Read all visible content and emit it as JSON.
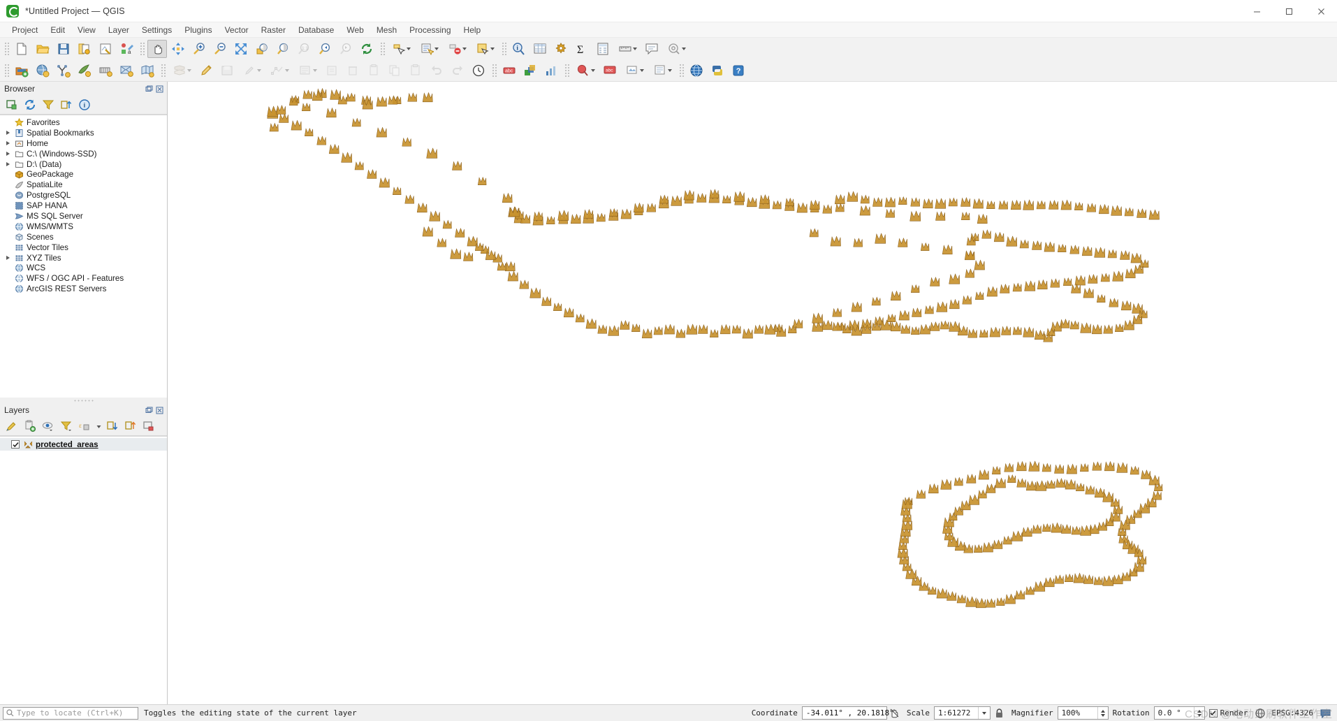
{
  "window": {
    "title": "*Untitled Project — QGIS",
    "logo_name": "qgis-logo",
    "minimize_label": "Minimize",
    "maximize_label": "Maximize",
    "close_label": "Close"
  },
  "menubar": [
    {
      "label": "Project"
    },
    {
      "label": "Edit"
    },
    {
      "label": "View"
    },
    {
      "label": "Layer"
    },
    {
      "label": "Settings"
    },
    {
      "label": "Plugins"
    },
    {
      "label": "Vector"
    },
    {
      "label": "Raster"
    },
    {
      "label": "Database"
    },
    {
      "label": "Web"
    },
    {
      "label": "Mesh"
    },
    {
      "label": "Processing"
    },
    {
      "label": "Help"
    }
  ],
  "browser_panel": {
    "title": "Browser",
    "toolbar": [
      {
        "name": "add-layer-icon",
        "tip": "Add Selected Layers"
      },
      {
        "name": "refresh-icon",
        "tip": "Refresh"
      },
      {
        "name": "filter-icon",
        "tip": "Filter Browser"
      },
      {
        "name": "collapse-all-icon",
        "tip": "Collapse All"
      },
      {
        "name": "properties-info-icon",
        "tip": "Enable/disable properties widget"
      }
    ],
    "items": [
      {
        "label": "Favorites",
        "icon": "star-icon",
        "expandable": false
      },
      {
        "label": "Spatial Bookmarks",
        "icon": "bookmark-icon",
        "expandable": true
      },
      {
        "label": "Home",
        "icon": "home-folder-icon",
        "expandable": true
      },
      {
        "label": "C:\\ (Windows-SSD)",
        "icon": "folder-icon",
        "expandable": true
      },
      {
        "label": "D:\\ (Data)",
        "icon": "folder-icon",
        "expandable": true
      },
      {
        "label": "GeoPackage",
        "icon": "geopackage-icon",
        "expandable": false
      },
      {
        "label": "SpatiaLite",
        "icon": "spatialite-icon",
        "expandable": false
      },
      {
        "label": "PostgreSQL",
        "icon": "postgresql-icon",
        "expandable": false
      },
      {
        "label": "SAP HANA",
        "icon": "sap-hana-icon",
        "expandable": false
      },
      {
        "label": "MS SQL Server",
        "icon": "mssql-icon",
        "expandable": false
      },
      {
        "label": "WMS/WMTS",
        "icon": "globe-icon",
        "expandable": false
      },
      {
        "label": "Scenes",
        "icon": "cube-icon",
        "expandable": false
      },
      {
        "label": "Vector Tiles",
        "icon": "grid-icon",
        "expandable": false
      },
      {
        "label": "XYZ Tiles",
        "icon": "grid-icon",
        "expandable": true
      },
      {
        "label": "WCS",
        "icon": "globe-icon",
        "expandable": false
      },
      {
        "label": "WFS / OGC API - Features",
        "icon": "globe-icon",
        "expandable": false
      },
      {
        "label": "ArcGIS REST Servers",
        "icon": "globe-icon",
        "expandable": false
      }
    ]
  },
  "layers_panel": {
    "title": "Layers",
    "toolbar": [
      {
        "name": "open-layer-styling-icon",
        "tip": "Open the Layer Styling panel"
      },
      {
        "name": "add-group-icon",
        "tip": "Add Group"
      },
      {
        "name": "manage-visibility-icon",
        "tip": "Manage Map Themes"
      },
      {
        "name": "filter-legend-icon",
        "tip": "Filter Legend"
      },
      {
        "name": "expression-filter-icon",
        "tip": "Filter Legend by Expression"
      },
      {
        "name": "expand-all-icon",
        "tip": "Expand All"
      },
      {
        "name": "collapse-all-icon",
        "tip": "Collapse All"
      },
      {
        "name": "remove-layer-icon",
        "tip": "Remove Layer/Group"
      }
    ],
    "layers": [
      {
        "name": "protected_areas",
        "checked": true,
        "editing": true,
        "icon": "point-layer-icon"
      }
    ]
  },
  "toolbar_rows": [
    {
      "groups": [
        {
          "buttons": [
            {
              "name": "new-project-icon",
              "label": "New Project"
            },
            {
              "name": "open-project-icon",
              "label": "Open Project"
            },
            {
              "name": "save-project-icon",
              "label": "Save Project"
            },
            {
              "name": "new-print-layout-icon",
              "label": "New Print Layout"
            },
            {
              "name": "style-manager-icon",
              "label": "Style Manager"
            },
            {
              "name": "show-layout-manager-icon",
              "label": "Layout Manager"
            }
          ]
        },
        {
          "buttons": [
            {
              "name": "pan-map-icon",
              "label": "Pan Map",
              "active": true
            },
            {
              "name": "pan-to-selection-icon",
              "label": "Pan Map to Selection"
            },
            {
              "name": "zoom-in-icon",
              "label": "Zoom In"
            },
            {
              "name": "zoom-out-icon",
              "label": "Zoom Out"
            },
            {
              "name": "zoom-full-icon",
              "label": "Zoom Full"
            },
            {
              "name": "zoom-to-selection-icon",
              "label": "Zoom to Selection"
            },
            {
              "name": "zoom-to-layer-icon",
              "label": "Zoom to Layer"
            },
            {
              "name": "zoom-native-icon",
              "label": "Zoom to Native Resolution",
              "disabled": true
            },
            {
              "name": "zoom-last-icon",
              "label": "Zoom Last"
            },
            {
              "name": "zoom-next-icon",
              "label": "Zoom Next",
              "disabled": true
            },
            {
              "name": "refresh-map-icon",
              "label": "Refresh"
            }
          ]
        },
        {
          "buttons": [
            {
              "name": "select-features-icon",
              "label": "Select Features",
              "dropdown": true
            },
            {
              "name": "select-by-value-icon",
              "label": "Select Features by Value",
              "dropdown": true
            },
            {
              "name": "deselect-icon",
              "label": "Deselect Features",
              "dropdown": true
            },
            {
              "name": "select-all-icon",
              "label": "Select All Features",
              "dropdown": true
            }
          ]
        },
        {
          "buttons": [
            {
              "name": "identify-features-icon",
              "label": "Identify Features"
            },
            {
              "name": "open-attribute-table-icon",
              "label": "Open Attribute Table"
            },
            {
              "name": "processing-toolbox-icon",
              "label": "Processing Toolbox"
            },
            {
              "name": "statistical-summary-icon",
              "label": "Statistical Summary"
            },
            {
              "name": "field-calculator-icon",
              "label": "Field Calculator"
            },
            {
              "name": "measure-line-icon",
              "label": "Measure Line",
              "dropdown": true
            },
            {
              "name": "show-map-tips-icon",
              "label": "Show Map Tips"
            },
            {
              "name": "new-map-view-icon",
              "label": "New Map View",
              "dropdown": true
            }
          ]
        }
      ]
    },
    {
      "groups": [
        {
          "buttons": [
            {
              "name": "add-vector-layer-icon",
              "label": "Add Vector Layer"
            },
            {
              "name": "add-raster-layer-icon",
              "label": "Add Raster Layer"
            },
            {
              "name": "add-delimited-text-icon",
              "label": "Add Delimited Text Layer"
            },
            {
              "name": "add-spatialite-layer-icon",
              "label": "Add SpatiaLite Layer"
            },
            {
              "name": "add-postgis-layer-icon",
              "label": "Add PostGIS Layer"
            },
            {
              "name": "add-mssql-layer-icon",
              "label": "Add MS SQL Server Layer"
            },
            {
              "name": "add-wms-layer-icon",
              "label": "Add WMS/WMTS Layer"
            }
          ]
        },
        {
          "buttons": [
            {
              "name": "current-edits-icon",
              "label": "Current Edits",
              "dropdown": true
            },
            {
              "name": "toggle-editing-icon",
              "label": "Toggle Editing"
            },
            {
              "name": "save-layer-edits-icon",
              "label": "Save Layer Edits"
            },
            {
              "name": "add-point-feature-icon",
              "label": "Add Point Feature",
              "dropdown": true
            },
            {
              "name": "vertex-tool-icon",
              "label": "Vertex Tool",
              "dropdown": true
            },
            {
              "name": "modify-attributes-icon",
              "label": "Modify Attributes of Selected Features",
              "dropdown": true
            },
            {
              "name": "move-feature-icon",
              "label": "Move Feature"
            },
            {
              "name": "delete-selected-icon",
              "label": "Delete Selected"
            },
            {
              "name": "cut-features-icon",
              "label": "Cut Features"
            },
            {
              "name": "copy-features-icon",
              "label": "Copy Features"
            },
            {
              "name": "paste-features-icon",
              "label": "Paste Features"
            },
            {
              "name": "undo-icon",
              "label": "Undo"
            },
            {
              "name": "redo-icon",
              "label": "Redo"
            },
            {
              "name": "temporal-controller-icon",
              "label": "Temporal Controller Panel"
            }
          ]
        },
        {
          "buttons": [
            {
              "name": "label-toolbar-icon",
              "label": "Layer Labeling Options"
            },
            {
              "name": "style-dock-icon",
              "label": "Layer Styling"
            },
            {
              "name": "diagram-icon",
              "label": "Diagram Options"
            }
          ]
        },
        {
          "buttons": [
            {
              "name": "annotation-point-icon",
              "label": "Text Annotation",
              "dropdown": true
            },
            {
              "name": "html-annotation-icon",
              "label": "HTML Annotation"
            },
            {
              "name": "svg-annotation-icon",
              "label": "SVG Annotation",
              "dropdown": true
            },
            {
              "name": "form-annotation-icon",
              "label": "Form Annotation",
              "dropdown": true
            }
          ]
        },
        {
          "buttons": [
            {
              "name": "plugin-metasearch-icon",
              "label": "MetaSearch"
            },
            {
              "name": "python-console-icon",
              "label": "Python Console"
            },
            {
              "name": "help-contents-icon",
              "label": "Help Contents"
            }
          ]
        }
      ]
    }
  ],
  "statusbar": {
    "locate_placeholder": "Type to locate (Ctrl+K)",
    "message": "Toggles the editing state of the current layer",
    "coordinate_label": "Coordinate",
    "coordinate_value": "-34.011° , 20.1818°",
    "toggle_extents_icon": "toggle-extents-icon",
    "scale_label": "Scale",
    "scale_value": "1:61272",
    "lock_icon": "lock-icon",
    "magnifier_label": "Magnifier",
    "magnifier_value": "100%",
    "rotation_label": "Rotation",
    "rotation_value": "0.0 °",
    "render_label": "Render",
    "render_checked": true,
    "crs_label": "EPSG:4326",
    "crs_icon": "crs-globe-icon",
    "message_log_icon": "message-log-icon",
    "watermark": "CSDN @电动牙刷软件工作室"
  },
  "map": {
    "background": "#ffffff",
    "marker_color": "#c8932f",
    "marker_color_dark": "#8a5f1c",
    "layer_name": "protected_areas"
  }
}
